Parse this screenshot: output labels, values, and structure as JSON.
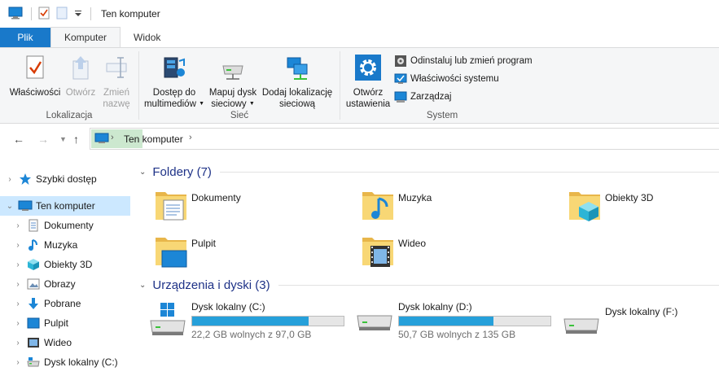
{
  "window": {
    "title": "Ten komputer"
  },
  "tabs": [
    {
      "label": "Plik"
    },
    {
      "label": "Komputer"
    },
    {
      "label": "Widok"
    }
  ],
  "ribbon": {
    "location_group": {
      "label": "Lokalizacja",
      "properties": "Właściwości",
      "open": "Otwórz",
      "rename_line1": "Zmień",
      "rename_line2": "nazwę"
    },
    "network_group": {
      "label": "Sieć",
      "media_line1": "Dostęp do",
      "media_line2": "multimediów",
      "map_line1": "Mapuj dysk",
      "map_line2": "sieciowy",
      "add_line1": "Dodaj lokalizację",
      "add_line2": "sieciową"
    },
    "system_group": {
      "label": "System",
      "settings_line1": "Otwórz",
      "settings_line2": "ustawienia",
      "uninstall": "Odinstaluj lub zmień program",
      "sys_props": "Właściwości systemu",
      "manage": "Zarządzaj"
    }
  },
  "address": {
    "path": "Ten komputer"
  },
  "navpane": {
    "items": [
      {
        "label": "Szybki dostęp",
        "icon": "star-icon"
      },
      {
        "label": "Ten komputer",
        "icon": "computer-icon"
      },
      {
        "label": "Dokumenty",
        "icon": "documents-icon"
      },
      {
        "label": "Muzyka",
        "icon": "music-icon"
      },
      {
        "label": "Obiekty 3D",
        "icon": "cube-icon"
      },
      {
        "label": "Obrazy",
        "icon": "pictures-icon"
      },
      {
        "label": "Pobrane",
        "icon": "download-icon"
      },
      {
        "label": "Pulpit",
        "icon": "desktop-icon"
      },
      {
        "label": "Wideo",
        "icon": "video-icon"
      },
      {
        "label": "Dysk lokalny (C:)",
        "icon": "drive-icon"
      }
    ]
  },
  "folders": {
    "heading": "Foldery (7)",
    "items": [
      {
        "name": "Dokumenty"
      },
      {
        "name": "Muzyka"
      },
      {
        "name": "Obiekty 3D"
      },
      {
        "name": "Pulpit"
      },
      {
        "name": "Wideo"
      }
    ]
  },
  "drives": {
    "heading": "Urządzenia i dyski (3)",
    "items": [
      {
        "name": "Dysk lokalny (C:)",
        "free": "22,2 GB wolnych z 97,0 GB",
        "used_fraction": 0.771
      },
      {
        "name": "Dysk lokalny (D:)",
        "free": "50,7 GB wolnych z 135 GB",
        "used_fraction": 0.624
      },
      {
        "name": "Dysk lokalny (F:)"
      }
    ]
  },
  "colors": {
    "accent": "#1979ca",
    "selected": "#cce8ff",
    "bar": "#26a0da",
    "heading": "#1e3287"
  }
}
